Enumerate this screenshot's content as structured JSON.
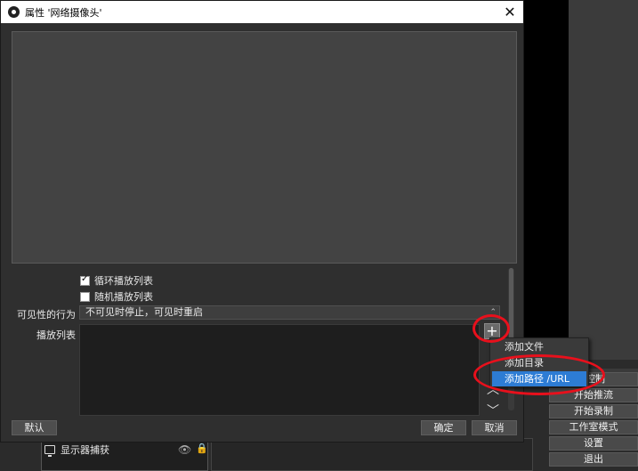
{
  "dialog": {
    "title": "属性 '网络摄像头'",
    "close_glyph": "✕"
  },
  "properties": {
    "loop_playlist": {
      "label": "循环播放列表",
      "checked": true
    },
    "shuffle_playlist": {
      "label": "随机播放列表",
      "checked": false
    },
    "visibility_behavior": {
      "label": "可见性的行为",
      "value": "不可见时停止，可见时重启"
    },
    "playlist": {
      "label": "播放列表"
    }
  },
  "playlist_buttons": {
    "add": "+",
    "up": "︿",
    "down": "﹀"
  },
  "context_menu": {
    "items": [
      {
        "label": "添加文件",
        "selected": false
      },
      {
        "label": "添加目录",
        "selected": false
      },
      {
        "label": "添加路径 /URL",
        "selected": true
      }
    ]
  },
  "footer": {
    "defaults": "默认",
    "ok": "确定",
    "cancel": "取消"
  },
  "background": {
    "source_item": "显示器捕获",
    "controls": [
      "控制",
      "开始推流",
      "开始录制",
      "工作室模式",
      "设置",
      "退出"
    ]
  },
  "colors": {
    "accent_selection": "#2d7cd4",
    "annotation_red": "#e8101c"
  }
}
